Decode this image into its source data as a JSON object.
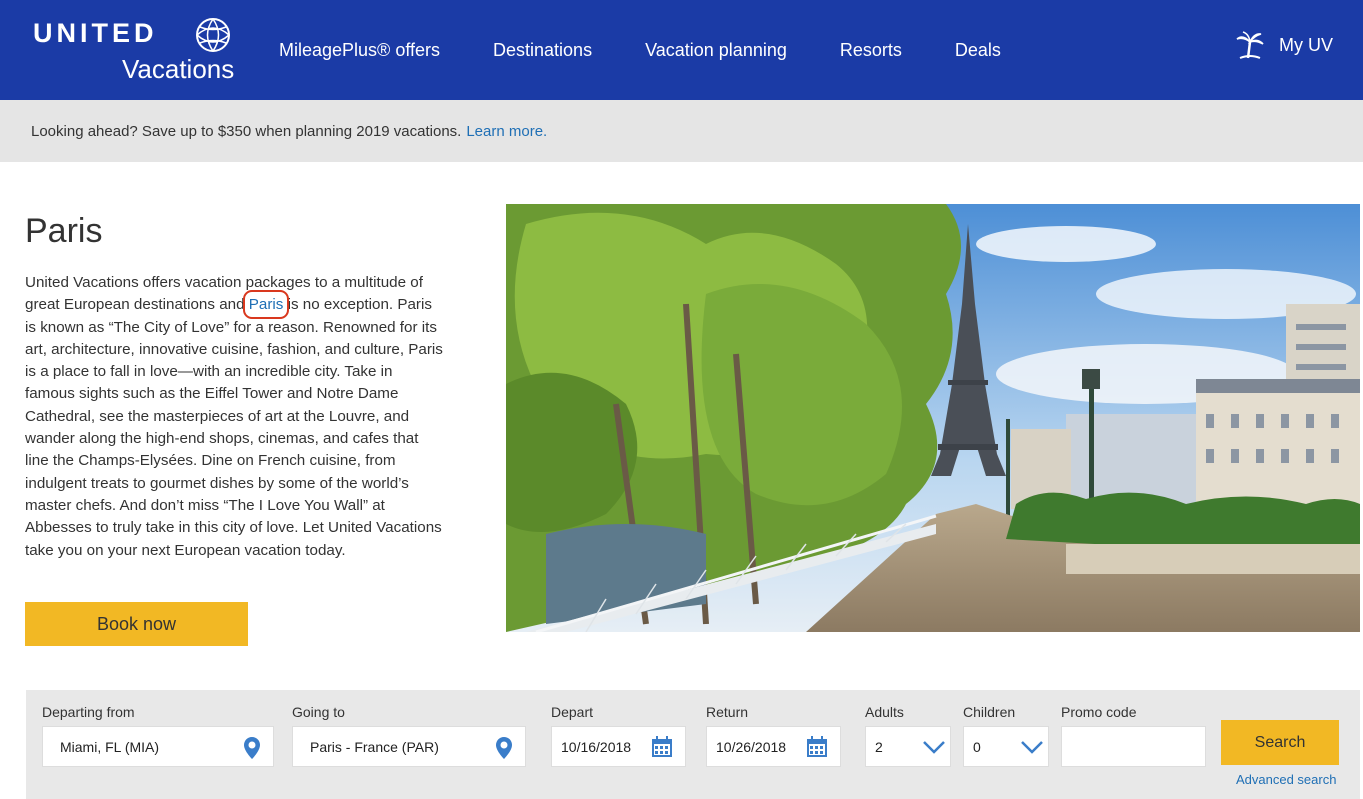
{
  "brand": {
    "word": "UNITED",
    "sub": "Vacations"
  },
  "nav": {
    "items": [
      "MileagePlus® offers",
      "Destinations",
      "Vacation planning",
      "Resorts",
      "Deals"
    ],
    "account": "My UV"
  },
  "promo": {
    "text": "Looking ahead? Save up to $350 when planning 2019 vacations.",
    "link": "Learn more."
  },
  "page": {
    "title": "Paris",
    "desc_before": "United Vacations offers vacation packages to a multitude of great European destinations and ",
    "desc_link": "Paris",
    "desc_after": " is no exception. Paris is known as “The City of Love” for a reason. Renowned for its art, architecture, innovative cuisine, fashion, and culture, Paris is a place to fall in love—with an incredible city. Take in famous sights such as the Eiffel Tower and Notre Dame Cathedral, see the masterpieces of art at the Louvre, and wander along the high-end shops, cinemas, and cafes that line the Champs-Elysées. Dine on French cuisine, from indulgent treats to gourmet dishes by some of the world’s master chefs. And don’t miss “The I Love You Wall” at Abbesses to truly take in this city of love. Let United Vacations take you on your next European vacation today.",
    "book_label": "Book now"
  },
  "search": {
    "departing": {
      "label": "Departing from",
      "value": "Miami, FL (MIA)"
    },
    "going": {
      "label": "Going to",
      "value": "Paris - France (PAR)"
    },
    "depart": {
      "label": "Depart",
      "value": "10/16/2018"
    },
    "return": {
      "label": "Return",
      "value": "10/26/2018"
    },
    "adults": {
      "label": "Adults",
      "value": "2"
    },
    "children": {
      "label": "Children",
      "value": "0"
    },
    "promo": {
      "label": "Promo code",
      "value": ""
    },
    "button": "Search",
    "advanced": "Advanced search"
  },
  "colors": {
    "nav": "#1b3ba6",
    "accent": "#f2b824",
    "link": "#1f6fb5",
    "promo_bg": "#e5e5e5"
  }
}
